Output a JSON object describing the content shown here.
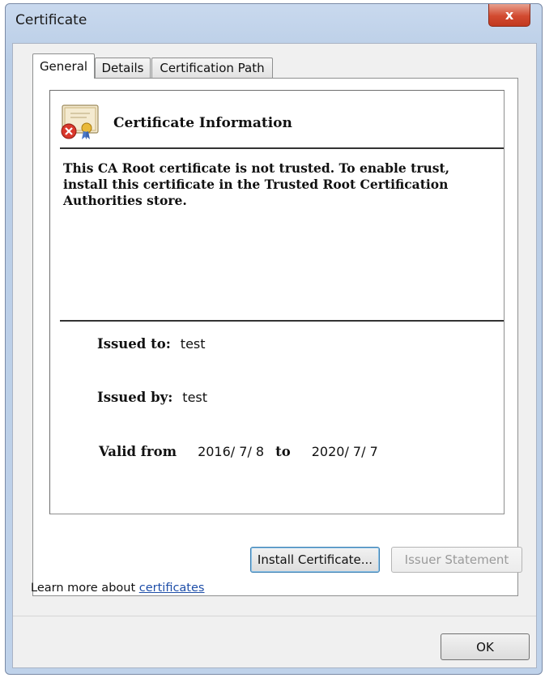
{
  "window": {
    "title": "Certificate",
    "close_glyph": "x"
  },
  "tabs": [
    {
      "label": "General",
      "active": true
    },
    {
      "label": "Details",
      "active": false
    },
    {
      "label": "Certification Path",
      "active": false
    }
  ],
  "general": {
    "heading": "Certificate Information",
    "warning": "This CA Root certificate is not trusted. To enable trust, install this certificate in the Trusted Root Certification Authorities store.",
    "issued_to_label": "Issued to:",
    "issued_to_value": "test",
    "issued_by_label": "Issued by:",
    "issued_by_value": "test",
    "valid_from_label": "Valid from",
    "valid_from_value": "2016/ 7/ 8",
    "valid_to_label": "to",
    "valid_to_value": "2020/ 7/ 7"
  },
  "buttons": {
    "install": "Install Certificate...",
    "issuer_statement": "Issuer Statement",
    "ok": "OK"
  },
  "footer": {
    "learn_more_prefix": "Learn more about ",
    "learn_more_link": "certificates"
  },
  "icons": {
    "certificate": "certificate-icon",
    "error_badge": "error-badge-icon",
    "close": "close-icon"
  },
  "colors": {
    "close_button": "#d24a30",
    "link": "#1e4ea8"
  }
}
